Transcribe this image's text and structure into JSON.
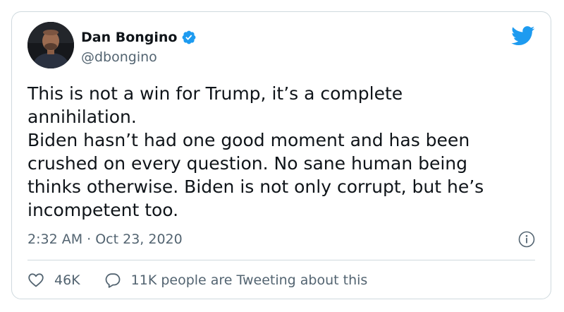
{
  "author": {
    "display_name": "Dan Bongino",
    "handle": "@dbongino",
    "verified": true
  },
  "tweet": {
    "lines": [
      "This is not a win for Trump, it’s a complete",
      "annihilation.",
      "Biden hasn’t had one good moment and has been",
      "crushed on every question. No sane human being",
      "thinks otherwise. Biden is not only corrupt, but he’s",
      "incompetent too."
    ],
    "timestamp": "2:32 AM · Oct 23, 2020"
  },
  "actions": {
    "like_count": "46K",
    "tweeting_text": "11K people are Tweeting about this"
  },
  "icons": {
    "brand": "twitter-bird-icon",
    "verified": "verified-badge-icon",
    "info": "info-icon",
    "like": "heart-icon",
    "reply": "speech-bubble-icon"
  },
  "colors": {
    "brand": "#1d9bf0",
    "text": "#0f1419",
    "secondary_text": "#536471",
    "border": "#cfd9de"
  }
}
